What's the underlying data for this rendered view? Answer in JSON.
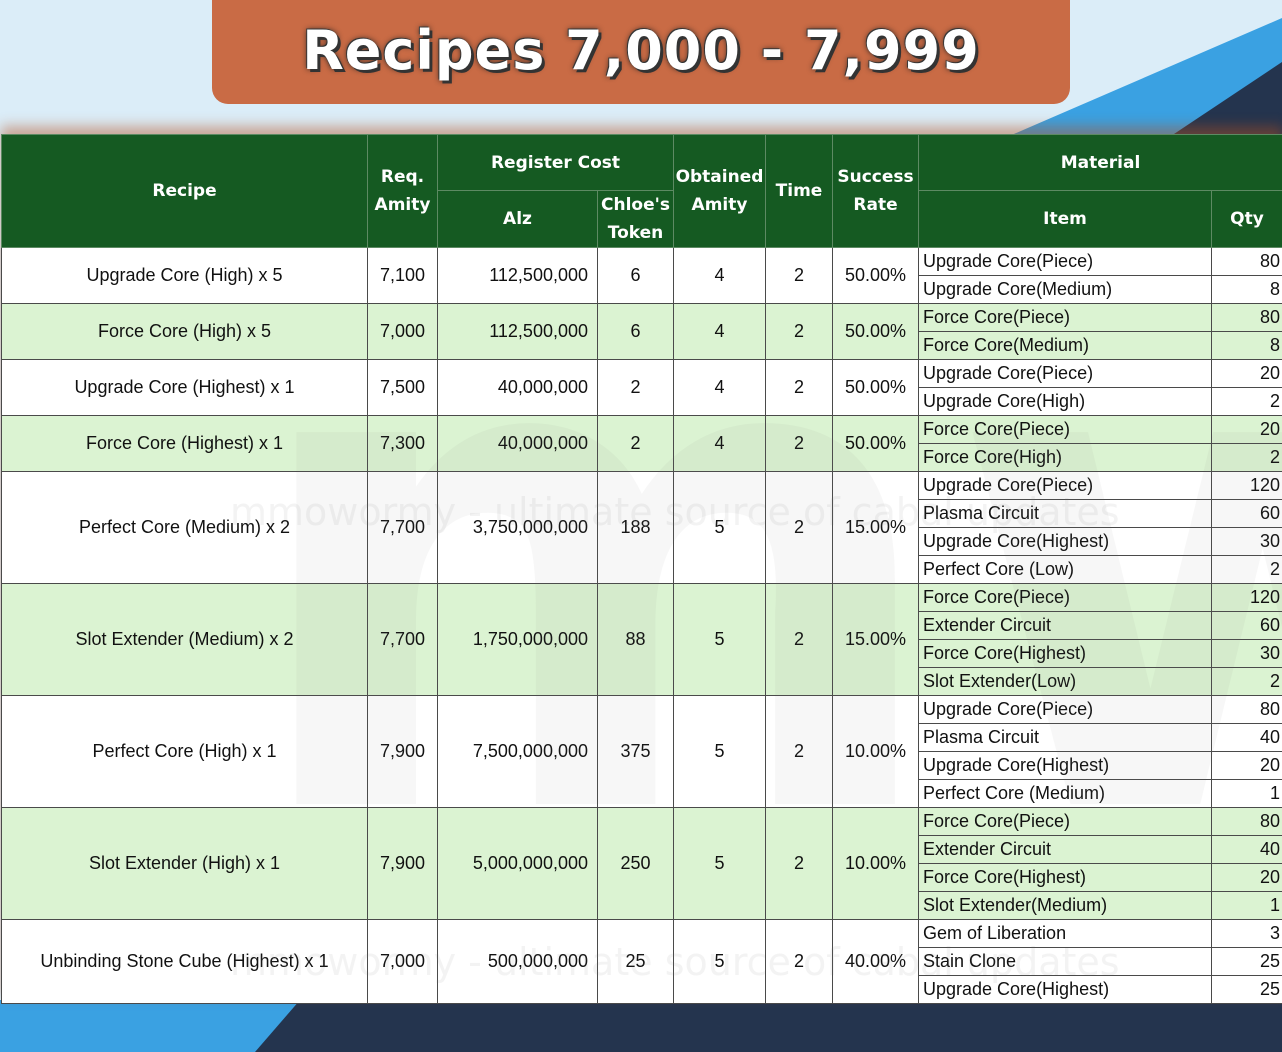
{
  "title": "Recipes 7,000 - 7,999",
  "watermark": "mmowormy - ultimate source of cabal updates",
  "headers": {
    "recipe": "Recipe",
    "req_amity_1": "Req.",
    "req_amity_2": "Amity",
    "register_cost": "Register Cost",
    "alz": "Alz",
    "chloes_token_1": "Chloe's",
    "chloes_token_2": "Token",
    "obtained_amity_1": "Obtained",
    "obtained_amity_2": "Amity",
    "time": "Time",
    "success_rate_1": "Success",
    "success_rate_2": "Rate",
    "material": "Material",
    "item": "Item",
    "qty": "Qty"
  },
  "rows": [
    {
      "recipe": "Upgrade Core (High) x 5",
      "amity": "7,100",
      "alz": "112,500,000",
      "token": "6",
      "obtained": "4",
      "time": "2",
      "rate": "50.00%",
      "materials": [
        {
          "item": "Upgrade Core(Piece)",
          "qty": "80"
        },
        {
          "item": "Upgrade Core(Medium)",
          "qty": "8"
        }
      ]
    },
    {
      "recipe": "Force Core (High) x 5",
      "amity": "7,000",
      "alz": "112,500,000",
      "token": "6",
      "obtained": "4",
      "time": "2",
      "rate": "50.00%",
      "materials": [
        {
          "item": "Force Core(Piece)",
          "qty": "80"
        },
        {
          "item": "Force Core(Medium)",
          "qty": "8"
        }
      ]
    },
    {
      "recipe": "Upgrade Core (Highest) x 1",
      "amity": "7,500",
      "alz": "40,000,000",
      "token": "2",
      "obtained": "4",
      "time": "2",
      "rate": "50.00%",
      "materials": [
        {
          "item": "Upgrade Core(Piece)",
          "qty": "20"
        },
        {
          "item": "Upgrade Core(High)",
          "qty": "2"
        }
      ]
    },
    {
      "recipe": "Force Core (Highest) x 1",
      "amity": "7,300",
      "alz": "40,000,000",
      "token": "2",
      "obtained": "4",
      "time": "2",
      "rate": "50.00%",
      "materials": [
        {
          "item": "Force Core(Piece)",
          "qty": "20"
        },
        {
          "item": "Force Core(High)",
          "qty": "2"
        }
      ]
    },
    {
      "recipe": "Perfect Core (Medium) x 2",
      "amity": "7,700",
      "alz": "3,750,000,000",
      "token": "188",
      "obtained": "5",
      "time": "2",
      "rate": "15.00%",
      "materials": [
        {
          "item": "Upgrade Core(Piece)",
          "qty": "120"
        },
        {
          "item": "Plasma Circuit",
          "qty": "60"
        },
        {
          "item": "Upgrade Core(Highest)",
          "qty": "30"
        },
        {
          "item": "Perfect Core (Low)",
          "qty": "2"
        }
      ]
    },
    {
      "recipe": "Slot Extender (Medium) x 2",
      "amity": "7,700",
      "alz": "1,750,000,000",
      "token": "88",
      "obtained": "5",
      "time": "2",
      "rate": "15.00%",
      "materials": [
        {
          "item": "Force Core(Piece)",
          "qty": "120"
        },
        {
          "item": "Extender Circuit",
          "qty": "60"
        },
        {
          "item": "Force Core(Highest)",
          "qty": "30"
        },
        {
          "item": "Slot Extender(Low)",
          "qty": "2"
        }
      ]
    },
    {
      "recipe": "Perfect Core (High) x 1",
      "amity": "7,900",
      "alz": "7,500,000,000",
      "token": "375",
      "obtained": "5",
      "time": "2",
      "rate": "10.00%",
      "materials": [
        {
          "item": "Upgrade Core(Piece)",
          "qty": "80"
        },
        {
          "item": "Plasma Circuit",
          "qty": "40"
        },
        {
          "item": "Upgrade Core(Highest)",
          "qty": "20"
        },
        {
          "item": "Perfect Core (Medium)",
          "qty": "1"
        }
      ]
    },
    {
      "recipe": "Slot Extender (High) x 1",
      "amity": "7,900",
      "alz": "5,000,000,000",
      "token": "250",
      "obtained": "5",
      "time": "2",
      "rate": "10.00%",
      "materials": [
        {
          "item": "Force Core(Piece)",
          "qty": "80"
        },
        {
          "item": "Extender Circuit",
          "qty": "40"
        },
        {
          "item": "Force Core(Highest)",
          "qty": "20"
        },
        {
          "item": "Slot Extender(Medium)",
          "qty": "1"
        }
      ]
    },
    {
      "recipe": "Unbinding Stone Cube (Highest) x 1",
      "amity": "7,000",
      "alz": "500,000,000",
      "token": "25",
      "obtained": "5",
      "time": "2",
      "rate": "40.00%",
      "materials": [
        {
          "item": "Gem of Liberation",
          "qty": "3"
        },
        {
          "item": "Stain Clone",
          "qty": "25"
        },
        {
          "item": "Upgrade Core(Highest)",
          "qty": "25"
        }
      ]
    }
  ],
  "colors": {
    "header_green": "#155a22",
    "row_green": "#dbf3d2",
    "title_orange": "#c96b45",
    "navy": "#24344e",
    "blue_accent": "#3a9fe0"
  }
}
